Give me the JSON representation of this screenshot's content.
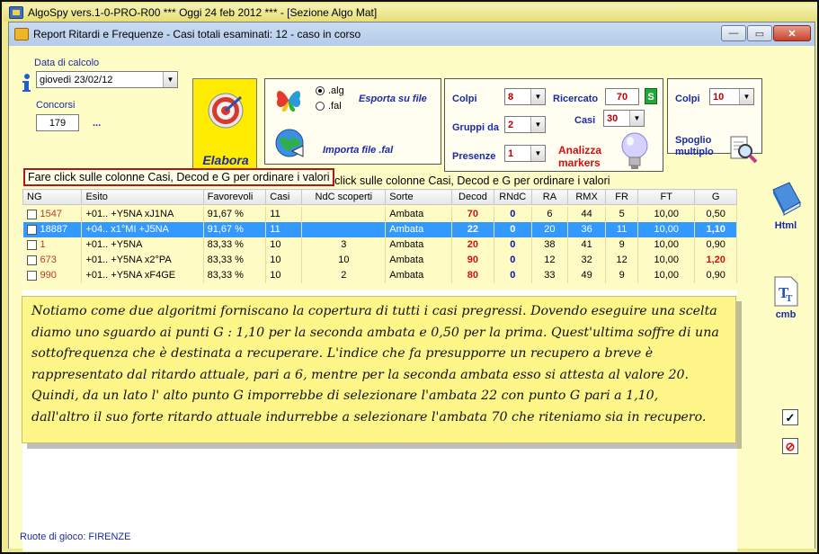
{
  "outer_title": "AlgoSpy vers.1-0-PRO-R00  ***  Oggi 24 feb 2012  ***   - [Sezione Algo Mat]",
  "window_title": "Report Ritardi e Frequenze - Casi totali esaminati: 12 - caso in corso",
  "window_buttons": {
    "minimize": "—",
    "restore": "▭",
    "close": "✕"
  },
  "calc": {
    "date_label": "Data di calcolo",
    "date_value": "giovedì 23/02/12",
    "concorsi_label": "Concorsi",
    "concorsi_value": "179",
    "ellipsis": "..."
  },
  "elabora_label": "Elabora",
  "file_panel": {
    "opt_alg": ".alg",
    "opt_fal": ".fal",
    "esporta": "Esporta su file",
    "importa": "Importa file .fal"
  },
  "params": {
    "colpi_label": "Colpi",
    "colpi_value": "8",
    "gruppi_label": "Gruppi da",
    "gruppi_value": "2",
    "presenze_label": "Presenze",
    "presenze_value": "1",
    "ricercato_label": "Ricercato",
    "ricercato_value": "70",
    "s_badge": "S",
    "casi_label": "Casi",
    "casi_value": "30",
    "analizza_label": "Analizza markers"
  },
  "spoglio": {
    "colpi_label": "Colpi",
    "colpi_value": "10",
    "spoglio_label": "Spoglio multiplo"
  },
  "tooltip_text": "Fare click sulle colonne Casi, Decod e G per ordinare i valori",
  "table": {
    "columns": [
      "NG",
      "Esito",
      "Favorevoli",
      "Casi",
      "NdC scoperti",
      "Sorte",
      "Decod",
      "RNdC",
      "RA",
      "RMX",
      "FR",
      "FT",
      "G"
    ],
    "rows": [
      {
        "ng": "1547",
        "esito": "+01.. +Y5NA xJ1NA",
        "fav": "91,67 %",
        "casi": "11",
        "ndc": "",
        "sorte": "Ambata",
        "decod": "70",
        "rndc": "0",
        "ra": "6",
        "rmx": "44",
        "fr": "5",
        "ft": "10,00",
        "g": "0,50"
      },
      {
        "ng": "18887",
        "esito": "+04.. x1°MI +J5NA",
        "fav": "91,67 %",
        "casi": "11",
        "ndc": "",
        "sorte": "Ambata",
        "decod": "22",
        "rndc": "0",
        "ra": "20",
        "rmx": "36",
        "fr": "11",
        "ft": "10,00",
        "g": "1,10"
      },
      {
        "ng": "1",
        "esito": "+01.. +Y5NA",
        "fav": "83,33 %",
        "casi": "10",
        "ndc": "3",
        "sorte": "Ambata",
        "decod": "20",
        "rndc": "0",
        "ra": "38",
        "rmx": "41",
        "fr": "9",
        "ft": "10,00",
        "g": "0,90"
      },
      {
        "ng": "673",
        "esito": "+01.. +Y5NA x2°PA",
        "fav": "83,33 %",
        "casi": "10",
        "ndc": "10",
        "sorte": "Ambata",
        "decod": "90",
        "rndc": "0",
        "ra": "12",
        "rmx": "32",
        "fr": "12",
        "ft": "10,00",
        "g": "1,20"
      },
      {
        "ng": "990",
        "esito": "+01.. +Y5NA xF4GE",
        "fav": "83,33 %",
        "casi": "10",
        "ndc": "2",
        "sorte": "Ambata",
        "decod": "80",
        "rndc": "0",
        "ra": "33",
        "rmx": "49",
        "fr": "9",
        "ft": "10,00",
        "g": "0,90"
      }
    ]
  },
  "note_lines": [
    "Notiamo come due algoritmi forniscano la copertura di tutti i casi pregressi. Dovendo eseguire una scelta",
    "diamo uno sguardo ai punti G : 1,10 per la seconda ambata e 0,50 per la prima. Quest'ultima soffre di una",
    "sottofrequenza che è destinata a recuperare. L'indice che fa presupporre un recupero a breve è",
    "rappresentato dal ritardo attuale, pari a 6, mentre per la seconda ambata esso si attesta al valore 20.",
    "Quindi, da un lato l' alto punto G imporrebbe di selezionare l'ambata 22 con punto G pari a 1,10,",
    "dall'altro il suo forte ritardo attuale indurrebbe a selezionare l'ambata 70 che riteniamo sia in recupero."
  ],
  "side": {
    "html_label": "Html",
    "cmb_label": "cmb",
    "check_glyph": "✓",
    "stop_glyph": "⊘"
  },
  "status_text": "Ruote di gioco: FIRENZE",
  "colors": {
    "accent_blue": "#1a2aa8",
    "red": "#d01010",
    "selection": "#3399ff",
    "note_bg": "#fff68a"
  }
}
